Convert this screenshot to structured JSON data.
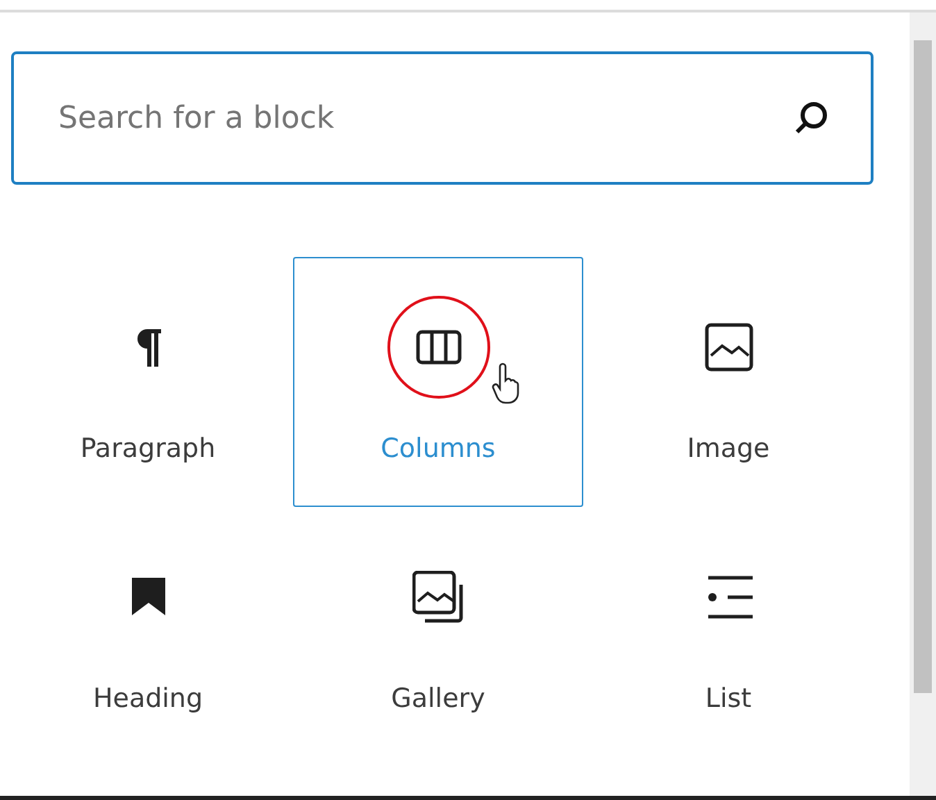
{
  "search": {
    "placeholder": "Search for a block"
  },
  "blocks": [
    {
      "label": "Paragraph",
      "kind": "paragraph",
      "selected": false,
      "circled": false
    },
    {
      "label": "Columns",
      "kind": "columns",
      "selected": true,
      "circled": true
    },
    {
      "label": "Image",
      "kind": "image",
      "selected": false,
      "circled": false
    },
    {
      "label": "Heading",
      "kind": "heading",
      "selected": false,
      "circled": false
    },
    {
      "label": "Gallery",
      "kind": "gallery",
      "selected": false,
      "circled": false
    },
    {
      "label": "List",
      "kind": "list",
      "selected": false,
      "circled": false
    }
  ]
}
